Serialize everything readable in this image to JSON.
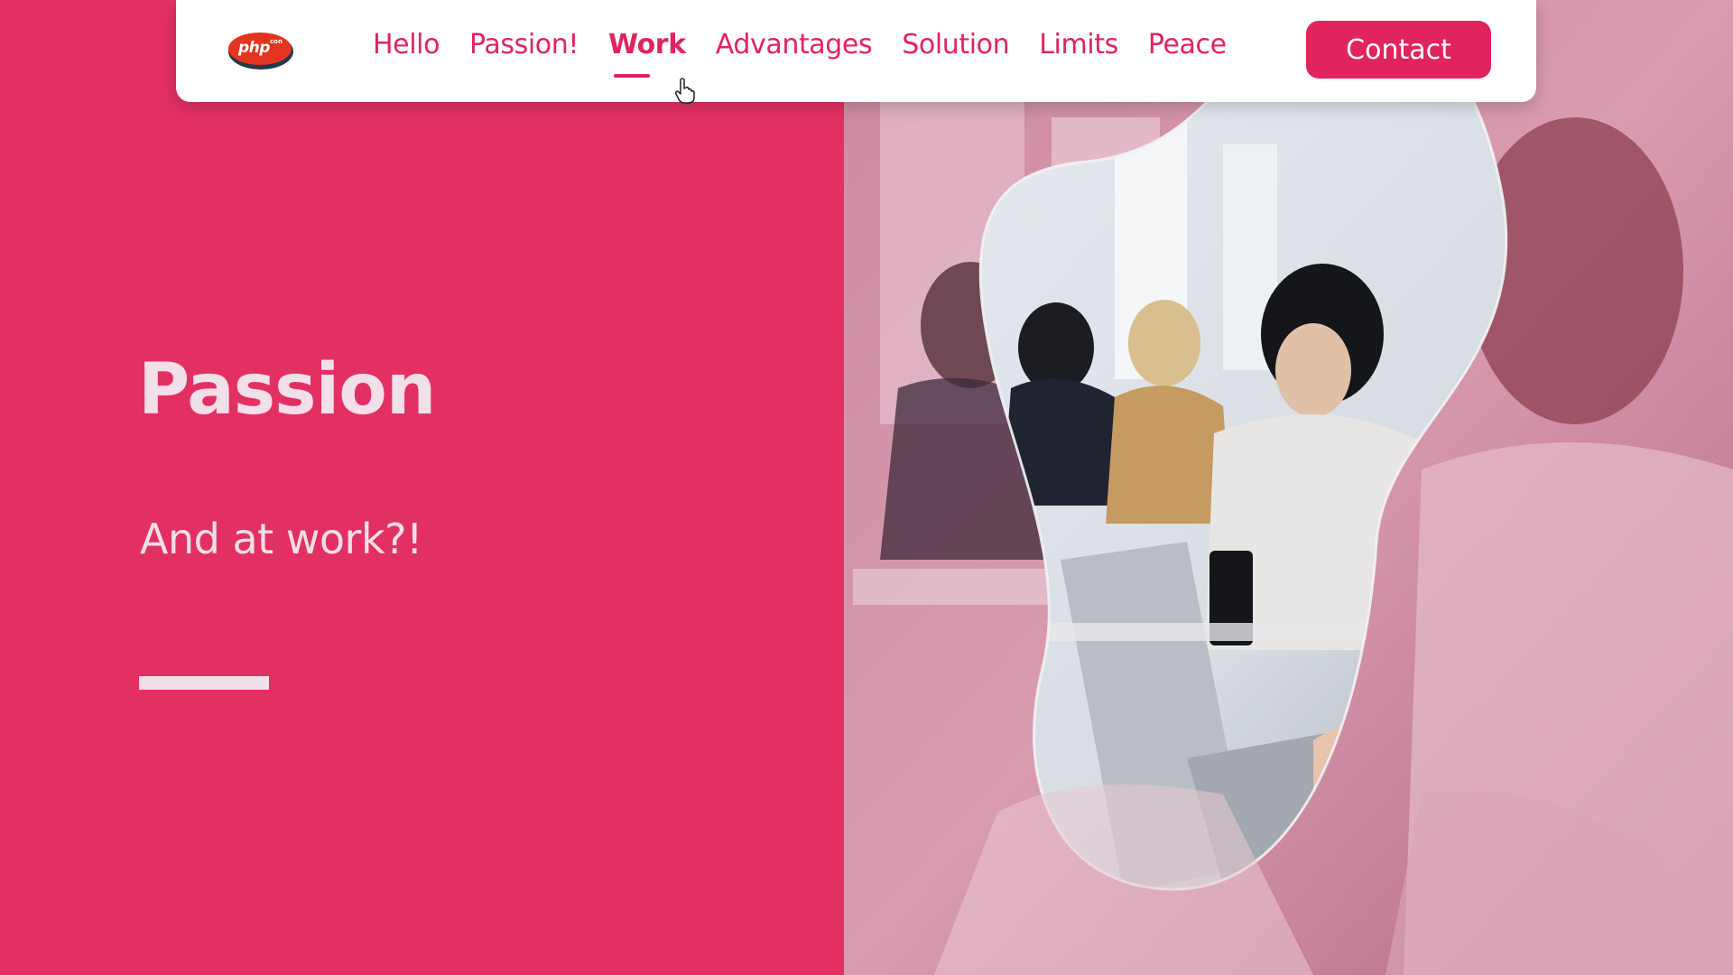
{
  "nav": {
    "logo": {
      "text": "php",
      "superscript": "con",
      "icon": "phpcon-logo",
      "color": "#e2341f"
    },
    "items": [
      {
        "label": "Hello",
        "active": false
      },
      {
        "label": "Passion!",
        "active": false
      },
      {
        "label": "Work",
        "active": true
      },
      {
        "label": "Advantages",
        "active": false
      },
      {
        "label": "Solution",
        "active": false
      },
      {
        "label": "Limits",
        "active": false
      },
      {
        "label": "Peace",
        "active": false
      }
    ],
    "contact_label": "Contact"
  },
  "hero": {
    "title": "Passion",
    "subtitle": "And at work?!",
    "image_icon": "office-workers-photo"
  },
  "cursor": {
    "icon": "hand-pointer-icon"
  },
  "colors": {
    "accent": "#e0245e",
    "panel_background": "#e33063",
    "hero_text": "#f1dfe9",
    "navbar_background": "#ffffff"
  }
}
